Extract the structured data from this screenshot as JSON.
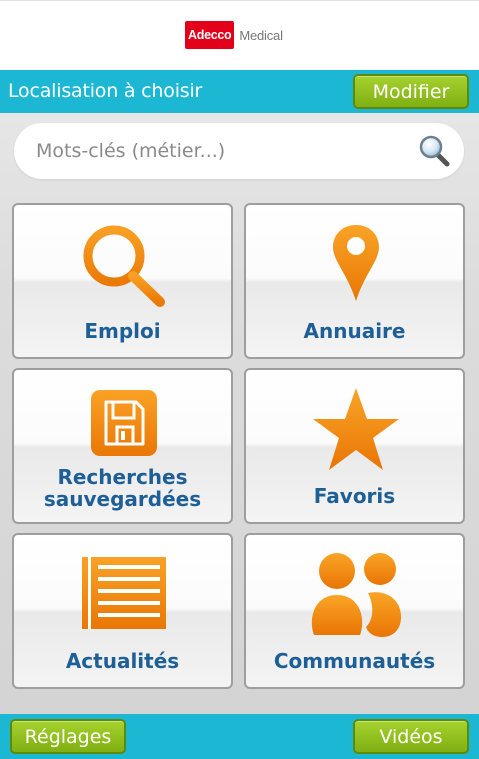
{
  "header": {
    "logo_brand": "Adecco",
    "logo_sub": "Medical"
  },
  "location_bar": {
    "text": "Localisation à choisir",
    "modify_label": "Modifier"
  },
  "search": {
    "placeholder": "Mots-clés (métier...)"
  },
  "tiles": [
    {
      "label": "Emploi",
      "icon": "magnifier-icon"
    },
    {
      "label": "Annuaire",
      "icon": "map-pin-icon"
    },
    {
      "label_line1": "Recherches",
      "label_line2": "sauvegardées",
      "icon": "floppy-disk-icon"
    },
    {
      "label": "Favoris",
      "icon": "star-icon"
    },
    {
      "label": "Actualités",
      "icon": "newspaper-icon"
    },
    {
      "label": "Communautés",
      "icon": "people-icon"
    }
  ],
  "footer": {
    "settings_label": "Réglages",
    "videos_label": "Vidéos"
  },
  "colors": {
    "accent_cyan": "#1cb8d3",
    "button_green": "#8cbd1c",
    "icon_orange": "#f08a0c",
    "label_blue": "#1d5f96",
    "brand_red": "#e2001a"
  }
}
